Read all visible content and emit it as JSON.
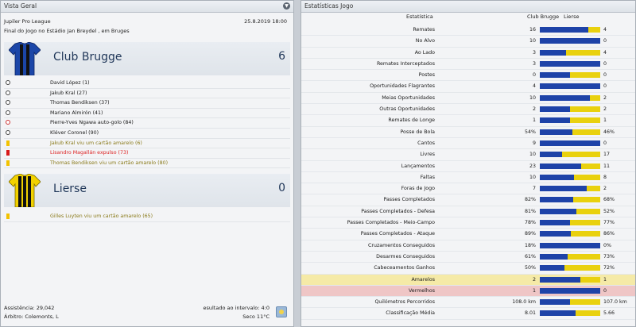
{
  "left": {
    "title": "Vista Geral",
    "competition": "Jupiler Pro League",
    "date": "25.8.2019 18:00",
    "venue": "Final do Jogo no Estádio Jan Breydel , em Bruges",
    "home": {
      "name": "Club Brugge",
      "score": "6",
      "colors": {
        "primary": "#1b46a8",
        "secondary": "#111111"
      },
      "events": [
        {
          "type": "goal",
          "text": "David López (1)"
        },
        {
          "type": "goal",
          "text": "Jakub Kral (27)"
        },
        {
          "type": "goal",
          "text": "Thomas Bendiksen (37)"
        },
        {
          "type": "goal",
          "text": "Mariano Almirón (41)"
        },
        {
          "type": "owngoal",
          "text": "Pierre-Yves Ngawa auto-golo (84)"
        },
        {
          "type": "goal",
          "text": "Kléver Coronel (90)"
        },
        {
          "type": "yellow",
          "text": "Jakub Kral viu um cartão amarelo (6)"
        },
        {
          "type": "red",
          "text": "Lisandro Magallán expulso (73)"
        },
        {
          "type": "yellow",
          "text": "Thomas Bendiksen viu um cartão amarelo (80)"
        }
      ]
    },
    "away": {
      "name": "Lierse",
      "score": "0",
      "colors": {
        "primary": "#f2d100",
        "secondary": "#111111"
      },
      "events": [
        {
          "type": "yellow",
          "text": "Gilles Luyten viu um cartão amarelo (65)"
        }
      ]
    },
    "footer": {
      "attendance": "Assistência: 29,042",
      "referee": "Árbitro: Colemonts, L",
      "halftime": "esultado ao intervalo: 4:0",
      "weather": "Seco 11°C"
    }
  },
  "right": {
    "title": "Estatísticas Jogo",
    "col_stat": "Estatística",
    "col_home": "Club Brugge",
    "col_away": "Lierse",
    "home_color": "#1e43a8",
    "away_color": "#e9d10e",
    "stats": [
      {
        "label": "Remates",
        "home": "16",
        "away": "4",
        "share": 0.8
      },
      {
        "label": "No Alvo",
        "home": "10",
        "away": "0",
        "share": 1.0
      },
      {
        "label": "Ao Lado",
        "home": "3",
        "away": "4",
        "share": 0.43
      },
      {
        "label": "Remates Interceptados",
        "home": "3",
        "away": "0",
        "share": 1.0
      },
      {
        "label": "Postes",
        "home": "0",
        "away": "0",
        "share": 0.5
      },
      {
        "label": "Oportunidades Flagrantes",
        "home": "4",
        "away": "0",
        "share": 1.0
      },
      {
        "label": "Meias Oportunidades",
        "home": "10",
        "away": "2",
        "share": 0.83
      },
      {
        "label": "Outras Oportunidades",
        "home": "2",
        "away": "2",
        "share": 0.5
      },
      {
        "label": "Remates de Longe",
        "home": "1",
        "away": "1",
        "share": 0.5
      },
      {
        "label": "Posse de Bola",
        "home": "54%",
        "away": "46%",
        "share": 0.54
      },
      {
        "label": "Cantos",
        "home": "9",
        "away": "0",
        "share": 1.0
      },
      {
        "label": "Livres",
        "home": "10",
        "away": "17",
        "share": 0.37
      },
      {
        "label": "Lançamentos",
        "home": "23",
        "away": "11",
        "share": 0.68
      },
      {
        "label": "Faltas",
        "home": "10",
        "away": "8",
        "share": 0.56
      },
      {
        "label": "Foras de Jogo",
        "home": "7",
        "away": "2",
        "share": 0.78
      },
      {
        "label": "Passes Completados",
        "home": "82%",
        "away": "68%",
        "share": 0.55
      },
      {
        "label": "Passes Completados - Defesa",
        "home": "81%",
        "away": "52%",
        "share": 0.61
      },
      {
        "label": "Passes Completados - Meio-Campo",
        "home": "78%",
        "away": "77%",
        "share": 0.5
      },
      {
        "label": "Passes Completados - Ataque",
        "home": "89%",
        "away": "86%",
        "share": 0.51
      },
      {
        "label": "Cruzamentos Conseguidos",
        "home": "18%",
        "away": "0%",
        "share": 1.0
      },
      {
        "label": "Desarmes Conseguidos",
        "home": "61%",
        "away": "73%",
        "share": 0.46
      },
      {
        "label": "Cabeceamentos Ganhos",
        "home": "50%",
        "away": "72%",
        "share": 0.41
      },
      {
        "label": "Amarelos",
        "home": "2",
        "away": "1",
        "share": 0.67,
        "highlight": "yellow"
      },
      {
        "label": "Vermelhos",
        "home": "1",
        "away": "0",
        "share": 1.0,
        "highlight": "red"
      },
      {
        "label": "Quilómetros Percorridos",
        "home": "108.0 km",
        "away": "107.0 km",
        "share": 0.5
      },
      {
        "label": "Classificação Média",
        "home": "8.01",
        "away": "5.66",
        "share": 0.59
      }
    ]
  }
}
